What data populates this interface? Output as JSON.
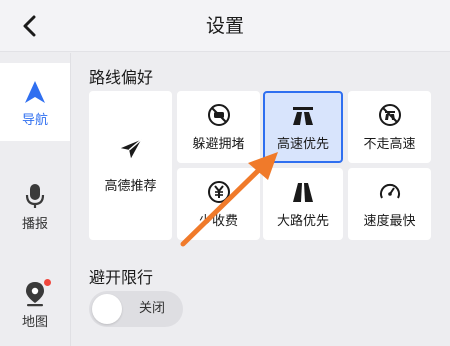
{
  "header": {
    "title": "设置",
    "back_icon": "back-chevron-icon"
  },
  "sidebar": {
    "items": [
      {
        "label": "导航",
        "icon": "navigation-arrow-icon",
        "active": true
      },
      {
        "label": "播报",
        "icon": "microphone-icon",
        "active": false
      },
      {
        "label": "地图",
        "icon": "map-pin-icon",
        "active": false,
        "badge": "red-dot"
      }
    ]
  },
  "route_preferences": {
    "title": "路线偏好",
    "options": [
      {
        "label": "高德推荐",
        "icon": "paper-plane-icon",
        "selected": false
      },
      {
        "label": "躲避拥堵",
        "icon": "avoid-congestion-icon",
        "selected": false
      },
      {
        "label": "高速优先",
        "icon": "highway-icon",
        "selected": true
      },
      {
        "label": "不走高速",
        "icon": "no-highway-icon",
        "selected": false
      },
      {
        "label": "少收费",
        "icon": "yuan-coin-icon",
        "selected": false
      },
      {
        "label": "大路优先",
        "icon": "main-road-icon",
        "selected": false
      },
      {
        "label": "速度最快",
        "icon": "speedometer-icon",
        "selected": false
      }
    ]
  },
  "restrictions": {
    "title": "避开限行",
    "toggle_label": "关闭",
    "toggle_on": false
  },
  "colors": {
    "accent": "#2f6ff0",
    "selected_bg": "#d8e4fc",
    "annotation_arrow": "#f07a2a",
    "badge": "#f0463c"
  }
}
